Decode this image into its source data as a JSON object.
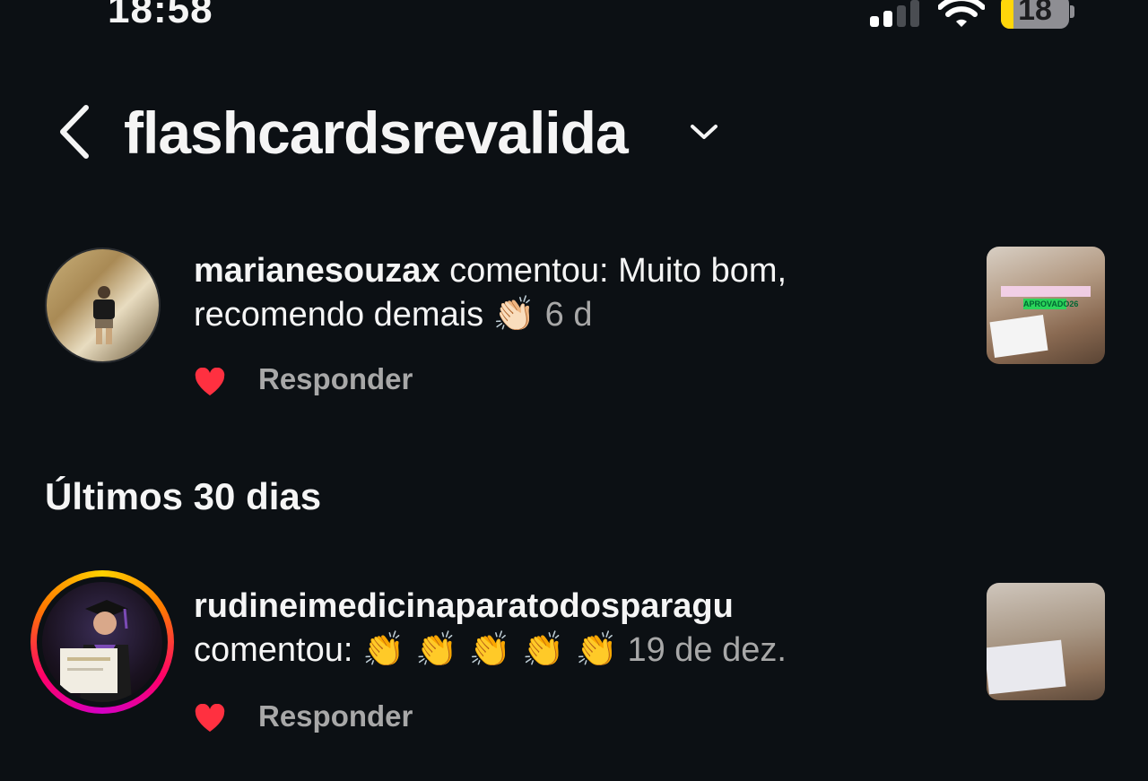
{
  "status_bar": {
    "time": "18:58",
    "battery": "18",
    "battery_level": 0.18
  },
  "header": {
    "title": "flashcardsrevalida"
  },
  "notifications": [
    {
      "username": "marianesouzax",
      "text_line1_rest": " comentou: Muito bom,",
      "text_line2": "recomendo demais ",
      "emoji": "👏🏻",
      "time": "6 d",
      "reply_label": "Responder",
      "thumbnail_tag": "APROVADO26"
    },
    {
      "username": "rudineimedicinaparatodosparagu",
      "text_line2": "comentou: ",
      "emoji": "👏 👏 👏 👏 👏",
      "time": "19 de dez.",
      "reply_label": "Responder"
    }
  ],
  "section_title": "Últimos 30 dias",
  "colors": {
    "background": "#0c1014",
    "heart": "#ff3040",
    "muted": "#a8a8a8"
  }
}
